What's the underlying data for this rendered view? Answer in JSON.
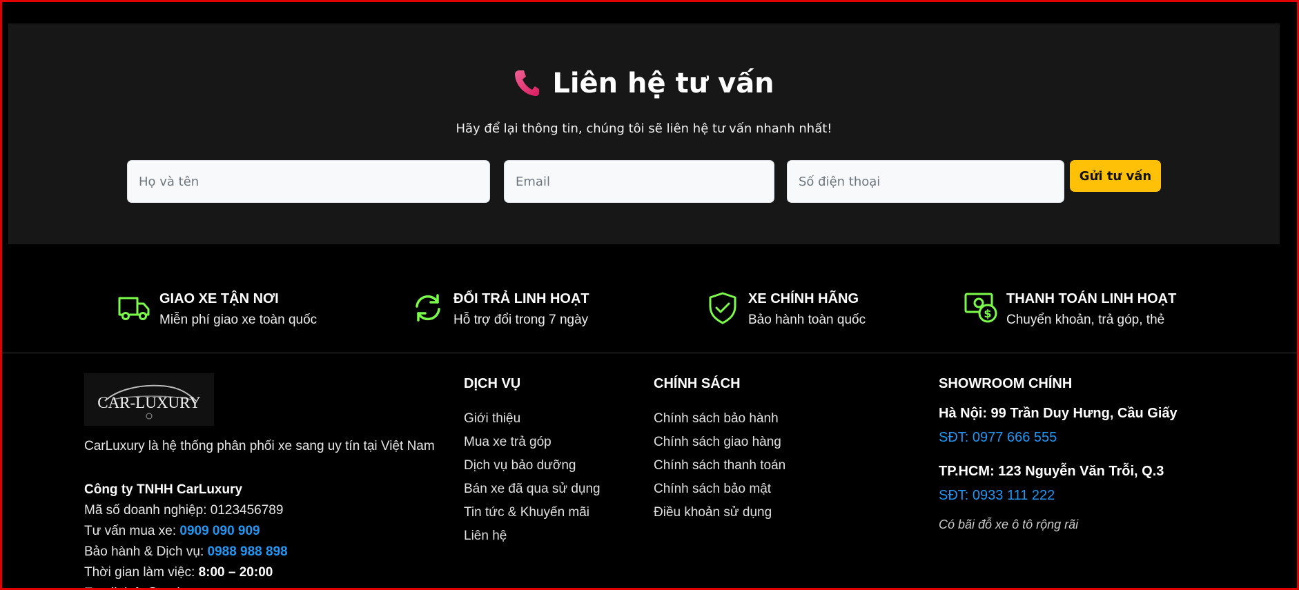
{
  "contact": {
    "title": "Liên hệ tư vấn",
    "subtitle": "Hãy để lại thông tin, chúng tôi sẽ liên hệ tư vấn nhanh nhất!",
    "name_placeholder": "Họ và tên",
    "email_placeholder": "Email",
    "phone_placeholder": "Số điện thoại",
    "submit_label": "Gửi tư vấn",
    "icon": "phone-icon",
    "icon_color": "#e83e8c",
    "button_color": "#ffc107"
  },
  "features": [
    {
      "title": "GIAO XE TẬN NƠI",
      "desc": "Miễn phí giao xe toàn quốc",
      "icon": "truck-icon"
    },
    {
      "title": "ĐỔI TRẢ LINH HOẠT",
      "desc": "Hỗ trợ đổi trong 7 ngày",
      "icon": "refresh-icon"
    },
    {
      "title": "XE CHÍNH HÃNG",
      "desc": "Bảo hành toàn quốc",
      "icon": "shield-check-icon"
    },
    {
      "title": "THANH TOÁN LINH HOẠT",
      "desc": "Chuyển khoản, trả góp, thẻ",
      "icon": "money-icon"
    }
  ],
  "feature_icon_color": "#7CFC4A",
  "footer": {
    "logo_text": "CAR-LUXURY",
    "about": "CarLuxury là hệ thống phân phối xe sang uy tín tại Việt Nam",
    "company_name": "Công ty TNHH CarLuxury",
    "tax_label": "Mã số doanh nghiệp: 0123456789",
    "sales_label": "Tư vấn mua xe:",
    "sales_phone": "0909 090 909",
    "service_label": "Bảo hành & Dịch vụ:",
    "service_phone": "0988 988 898",
    "hours_label": "Thời gian làm việc:",
    "hours": "8:00 – 20:00",
    "email_line": "Email: info@carluxury.vn",
    "link_color": "#2196f3",
    "services_heading": "DỊCH VỤ",
    "services": [
      "Giới thiệu",
      "Mua xe trả góp",
      "Dịch vụ bảo dưỡng",
      "Bán xe đã qua sử dụng",
      "Tin tức & Khuyến mãi",
      "Liên hệ"
    ],
    "policy_heading": "CHÍNH SÁCH",
    "policies": [
      "Chính sách bảo hành",
      "Chính sách giao hàng",
      "Chính sách thanh toán",
      "Chính sách bảo mật",
      "Điều khoản sử dụng"
    ],
    "showroom_heading": "SHOWROOM CHÍNH",
    "hanoi": "Hà Nội: 99 Trần Duy Hưng, Cầu Giấy",
    "hanoi_phone": "SĐT: 0977 666 555",
    "hcm": "TP.HCM: 123 Nguyễn Văn Trỗi, Q.3",
    "hcm_phone": "SĐT: 0933 111 222",
    "parking_note": "Có bãi đỗ xe ô tô rộng rãi"
  }
}
